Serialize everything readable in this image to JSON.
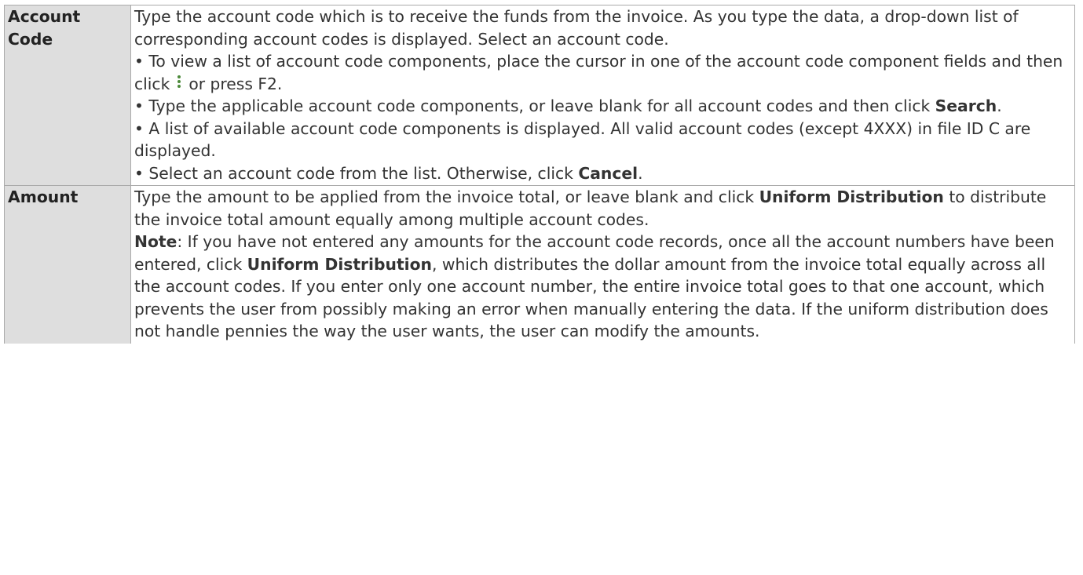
{
  "rows": [
    {
      "field": "Account Code",
      "intro": "Type the account code which is to receive the funds from the invoice. As you type the data, a drop-down list of corresponding account codes is displayed. Select an account code.",
      "bullet1_pre": "• To view a list of account code components, place the cursor in one of the account code component fields and then click",
      "bullet1_icon": "kebab-menu-icon",
      "bullet1_post": "or press F2.",
      "bullet2_pre": "• Type the applicable account code components, or leave blank for all account codes and then click ",
      "bullet2_bold": "Search",
      "bullet2_post": ".",
      "bullet3": "• A list of available account code components is displayed. All valid account codes (except 4XXX) in file ID C are displayed.",
      "bullet4_pre": "• Select an account code from the list. Otherwise, click ",
      "bullet4_bold": "Cancel",
      "bullet4_post": "."
    },
    {
      "field": "Amount",
      "p1_pre": "Type the amount to be applied from the invoice total, or leave blank and click ",
      "p1_bold": "Uniform Distribution",
      "p1_post": " to distribute the invoice total amount equally among multiple account codes.",
      "note_label": "Note",
      "note_pre": ": If you have not entered any amounts for the account code records, once all the account numbers have been entered, click ",
      "note_bold": "Uniform Distribution",
      "note_post": ", which distributes the dollar amount from the invoice total equally across all the account codes. If you enter only one account number, the entire invoice total goes to that one account, which prevents the user from possibly making an error when manually entering the data. If the uniform distribution does not handle pennies the way the user wants, the user can modify the amounts."
    }
  ]
}
